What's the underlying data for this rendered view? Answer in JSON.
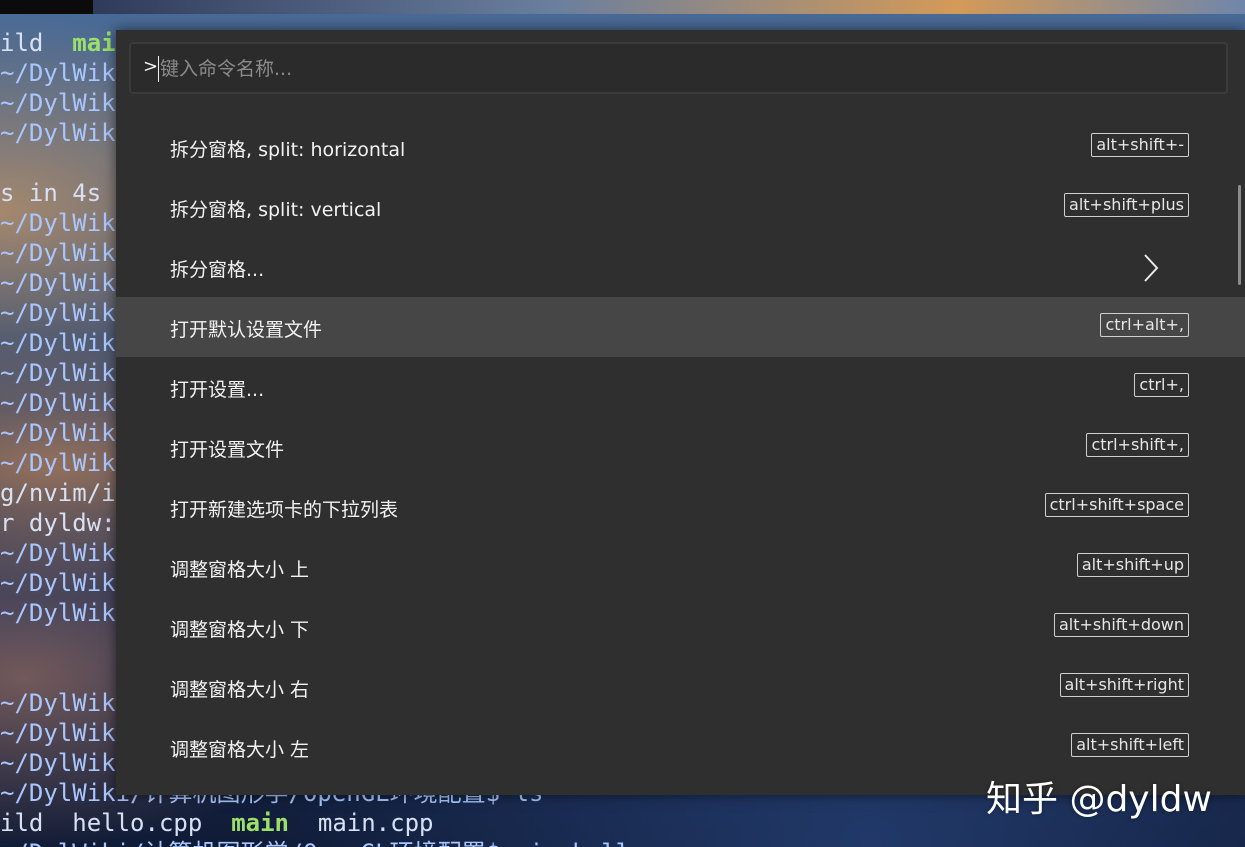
{
  "terminal": {
    "lines": [
      {
        "parts": [
          {
            "t": "ild  "
          },
          {
            "t": "mai",
            "c": "green"
          }
        ]
      },
      {
        "parts": [
          {
            "t": "~/DylWik",
            "c": "path"
          }
        ]
      },
      {
        "parts": [
          {
            "t": "~/DylWik",
            "c": "path"
          }
        ]
      },
      {
        "parts": [
          {
            "t": "~/DylWik",
            "c": "path"
          }
        ]
      },
      {
        "parts": []
      },
      {
        "parts": [
          {
            "t": "s in 4s"
          }
        ]
      },
      {
        "parts": [
          {
            "t": "~/DylWik",
            "c": "path"
          }
        ]
      },
      {
        "parts": [
          {
            "t": "~/DylWik",
            "c": "path"
          }
        ]
      },
      {
        "parts": [
          {
            "t": "~/DylWik",
            "c": "path"
          }
        ]
      },
      {
        "parts": [
          {
            "t": "~/DylWik",
            "c": "path"
          }
        ]
      },
      {
        "parts": [
          {
            "t": "~/DylWik",
            "c": "path"
          }
        ]
      },
      {
        "parts": [
          {
            "t": "~/DylWik",
            "c": "path"
          }
        ]
      },
      {
        "parts": [
          {
            "t": "~/DylWik",
            "c": "path"
          }
        ]
      },
      {
        "parts": [
          {
            "t": "~/DylWik",
            "c": "path"
          }
        ]
      },
      {
        "parts": [
          {
            "t": "~/DylWik",
            "c": "path"
          }
        ]
      },
      {
        "parts": [
          {
            "t": "g/nvim/i"
          }
        ]
      },
      {
        "parts": [
          {
            "t": "r dyldw:"
          }
        ]
      },
      {
        "parts": [
          {
            "t": "~/DylWik",
            "c": "path"
          }
        ]
      },
      {
        "parts": [
          {
            "t": "~/DylWik",
            "c": "path"
          }
        ]
      },
      {
        "parts": [
          {
            "t": "~/DylWik",
            "c": "path"
          }
        ]
      },
      {
        "parts": []
      },
      {
        "parts": []
      },
      {
        "parts": [
          {
            "t": "~/DylWik",
            "c": "path"
          }
        ]
      },
      {
        "parts": [
          {
            "t": "~/DylWik",
            "c": "path"
          }
        ]
      },
      {
        "parts": [
          {
            "t": "~/DylWik",
            "c": "path"
          }
        ]
      },
      {
        "parts": [
          {
            "t": "~/DylWiki/计算机图形学/OpenGL环境配置$ ls",
            "c": "path"
          }
        ]
      },
      {
        "parts": [
          {
            "t": "ild  hello.cpp  "
          },
          {
            "t": "main",
            "c": "green"
          },
          {
            "t": "  main.cpp"
          }
        ]
      },
      {
        "parts": [
          {
            "t": " /DylWiki/计算机图形学/OpenGL环境配置$ vim hello",
            "c": "path"
          }
        ]
      }
    ]
  },
  "palette": {
    "prompt": ">",
    "search_placeholder": "键入命令名称...",
    "search_value": "",
    "items": [
      {
        "label": "拆分窗格, split: horizontal",
        "shortcut": "alt+shift+-",
        "selected": false,
        "has_submenu": false,
        "name": "split-horizontal"
      },
      {
        "label": "拆分窗格, split: vertical",
        "shortcut": "alt+shift+plus",
        "selected": false,
        "has_submenu": false,
        "name": "split-vertical"
      },
      {
        "label": "拆分窗格...",
        "shortcut": "",
        "selected": false,
        "has_submenu": true,
        "name": "split-pane-submenu"
      },
      {
        "label": "打开默认设置文件",
        "shortcut": "ctrl+alt+,",
        "selected": true,
        "has_submenu": false,
        "name": "open-default-settings"
      },
      {
        "label": "打开设置...",
        "shortcut": "ctrl+,",
        "selected": false,
        "has_submenu": false,
        "name": "open-settings"
      },
      {
        "label": "打开设置文件",
        "shortcut": "ctrl+shift+,",
        "selected": false,
        "has_submenu": false,
        "name": "open-settings-file"
      },
      {
        "label": "打开新建选项卡的下拉列表",
        "shortcut": "ctrl+shift+space",
        "selected": false,
        "has_submenu": false,
        "name": "open-new-tab-dropdown"
      },
      {
        "label": "调整窗格大小 上",
        "shortcut": "alt+shift+up",
        "selected": false,
        "has_submenu": false,
        "name": "resize-pane-up"
      },
      {
        "label": "调整窗格大小 下",
        "shortcut": "alt+shift+down",
        "selected": false,
        "has_submenu": false,
        "name": "resize-pane-down"
      },
      {
        "label": "调整窗格大小 右",
        "shortcut": "alt+shift+right",
        "selected": false,
        "has_submenu": false,
        "name": "resize-pane-right"
      },
      {
        "label": "调整窗格大小 左",
        "shortcut": "alt+shift+left",
        "selected": false,
        "has_submenu": false,
        "name": "resize-pane-left"
      }
    ],
    "submenu_icon": "chevron-right-icon"
  },
  "watermark": {
    "text": "知乎 @dyldw"
  },
  "colors": {
    "palette_bg": "#2f2f2f",
    "selected_bg": "#464646",
    "text": "#f2f2f2",
    "placeholder": "#8b8b8b"
  }
}
